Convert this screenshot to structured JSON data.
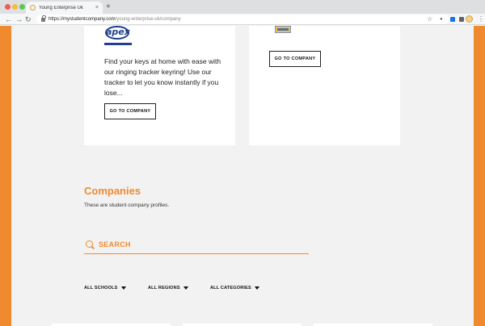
{
  "browser": {
    "tab_title": "Young Enterprise Uk",
    "tab_close": "×",
    "new_tab": "+",
    "url_host": "https://mystudentcompany.com",
    "url_path": "/young-enterprise-uk/company",
    "back": "←",
    "forward": "→",
    "reload": "↻",
    "star": "☆",
    "mic": "🎙",
    "menu": "⋮"
  },
  "cards": [
    {
      "logo_text": "apex",
      "description": "Find your keys at home with ease with our ringing tracker keyring! Use our tracker to let you know instantly if you lose...",
      "button_label": "GO TO COMPANY"
    },
    {
      "button_label": "GO TO COMPANY"
    }
  ],
  "section": {
    "title": "Companies",
    "subtitle": "These are student company profiles."
  },
  "search": {
    "placeholder": "SEARCH"
  },
  "filters": {
    "schools": "ALL SCHOOLS",
    "regions": "ALL REGIONS",
    "categories": "ALL CATEGORIES"
  },
  "colors": {
    "accent": "#f08a2e",
    "page_bg": "#f2f2f2",
    "card_bg": "#ffffff"
  }
}
